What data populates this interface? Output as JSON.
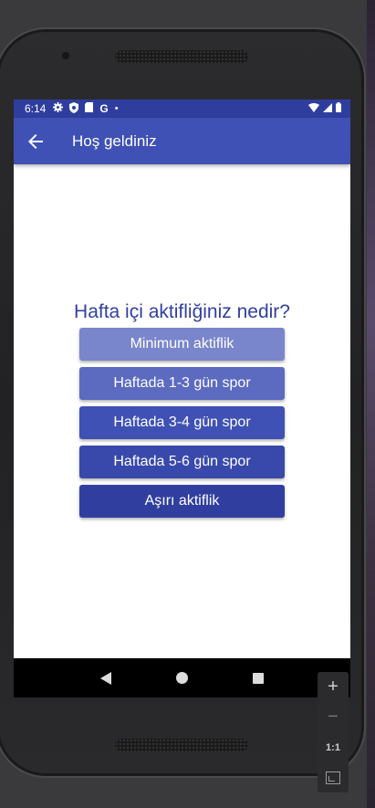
{
  "statusbar": {
    "time": "6:14",
    "g_label": "G",
    "dot": "•"
  },
  "appbar": {
    "title": "Hoş geldiniz",
    "back_icon": "arrow-back-icon"
  },
  "question": "Hafta içi aktifliğiniz nedir?",
  "options": [
    {
      "label": "Minimum aktiflik",
      "color": "#7986cb"
    },
    {
      "label": "Haftada 1-3 gün spor",
      "color": "#5c6bc0"
    },
    {
      "label": "Haftada 3-4 gün spor",
      "color": "#3f51b5"
    },
    {
      "label": "Haftada 5-6 gün spor",
      "color": "#3949ab"
    },
    {
      "label": "Aşırı aktiflik",
      "color": "#303f9f"
    }
  ],
  "zoom": {
    "plus": "+",
    "minus": "−",
    "ratio": "1:1"
  },
  "colors": {
    "primary": "#3f51b5",
    "primary_dark": "#2f3e9e",
    "question_text": "#303f9f"
  }
}
